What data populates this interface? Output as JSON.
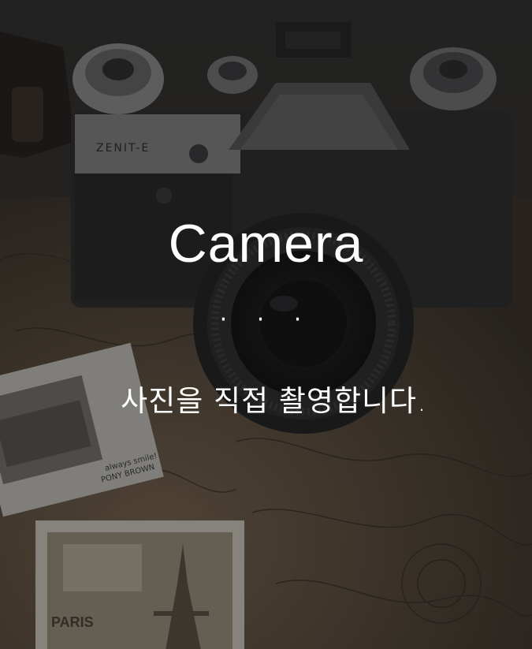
{
  "screen": {
    "title": "Camera",
    "separator": "· · ·",
    "subtitle": "사진을 직접 촬영합니다."
  },
  "background": {
    "camera_brand": "ZENIT-E",
    "card1_text": "always smile! PONY BROWN",
    "card2_text": "PARIS",
    "overlay_color": "#141414"
  }
}
